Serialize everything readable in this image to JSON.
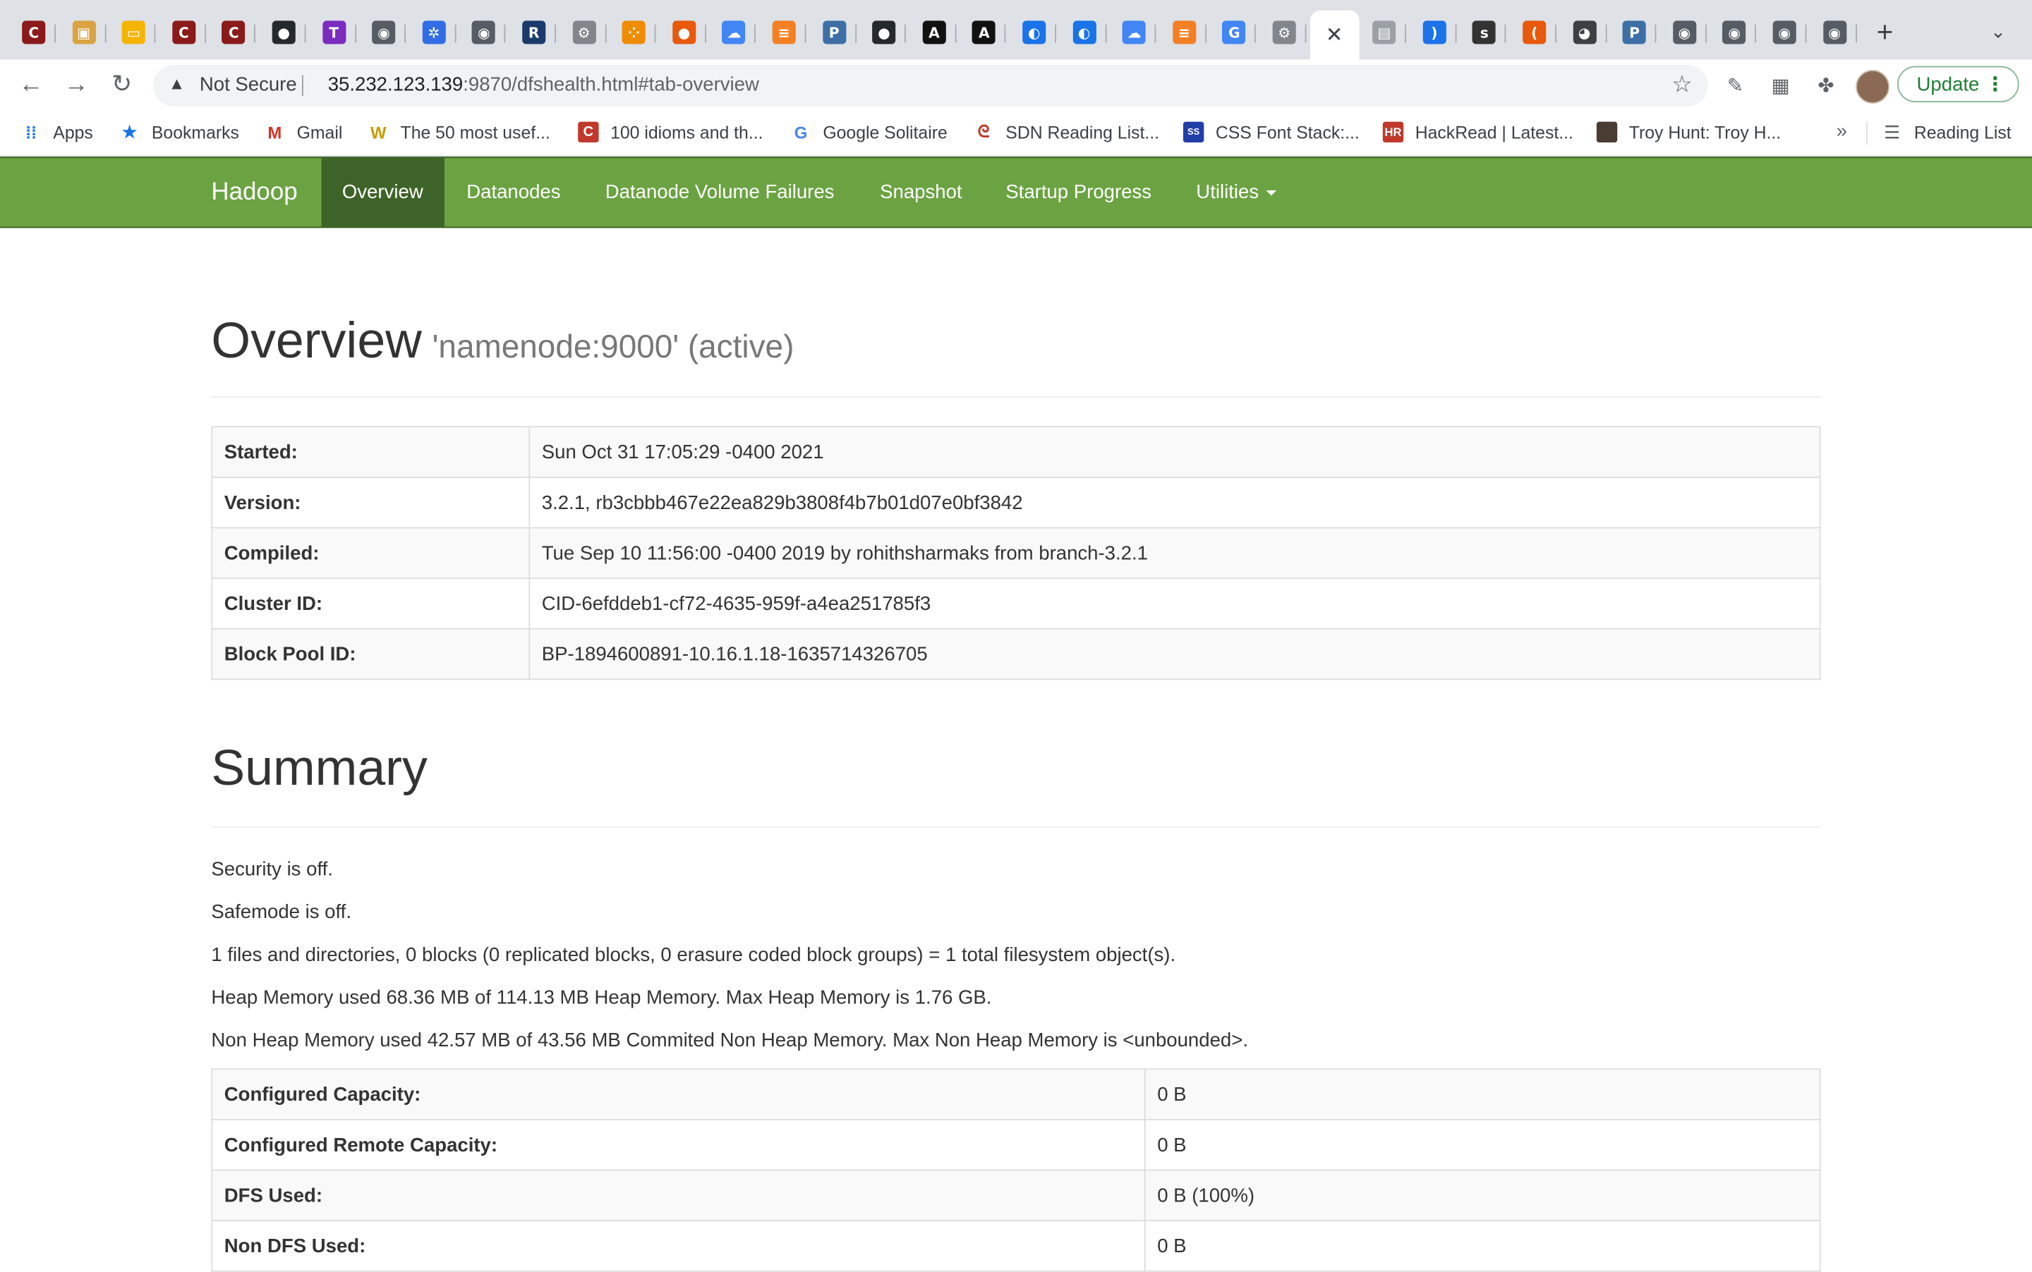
{
  "browser": {
    "tabs": [
      {
        "icon": "c-red-icon",
        "color": "#8b1a1a",
        "glyph": "C"
      },
      {
        "icon": "box-icon",
        "color": "#d9a441",
        "glyph": "▣"
      },
      {
        "icon": "slides-icon",
        "color": "#f4b400",
        "glyph": "▭"
      },
      {
        "icon": "c-red-icon",
        "color": "#8b1a1a",
        "glyph": "C"
      },
      {
        "icon": "c-red-icon",
        "color": "#8b1a1a",
        "glyph": "C"
      },
      {
        "icon": "github-icon",
        "color": "#24292e",
        "glyph": "●"
      },
      {
        "icon": "t-purple-icon",
        "color": "#7b2cbf",
        "glyph": "T"
      },
      {
        "icon": "docker-icon",
        "color": "#555c63",
        "glyph": "◉"
      },
      {
        "icon": "kubernetes-icon",
        "color": "#326ce5",
        "glyph": "✲"
      },
      {
        "icon": "docker-icon",
        "color": "#555c63",
        "glyph": "◉"
      },
      {
        "icon": "rm-icon",
        "color": "#1b3a6b",
        "glyph": "R"
      },
      {
        "icon": "gear-icon",
        "color": "#80868b",
        "glyph": "⚙"
      },
      {
        "icon": "dots-orange-icon",
        "color": "#f08c00",
        "glyph": "⁘"
      },
      {
        "icon": "orange-circle-icon",
        "color": "#e8590c",
        "glyph": "●"
      },
      {
        "icon": "cloud-icon",
        "color": "#4285f4",
        "glyph": "☁"
      },
      {
        "icon": "stackoverflow-icon",
        "color": "#f48024",
        "glyph": "≡"
      },
      {
        "icon": "p-blue-icon",
        "color": "#3d6fa6",
        "glyph": "P"
      },
      {
        "icon": "github-icon",
        "color": "#24292e",
        "glyph": "●"
      },
      {
        "icon": "a-dark-icon",
        "color": "#111111",
        "glyph": "A"
      },
      {
        "icon": "a-dark-icon",
        "color": "#111111",
        "glyph": "A"
      },
      {
        "icon": "globe-blue-icon",
        "color": "#1a73e8",
        "glyph": "◐"
      },
      {
        "icon": "globe-blue-icon",
        "color": "#1a73e8",
        "glyph": "◐"
      },
      {
        "icon": "cloud-icon",
        "color": "#4285f4",
        "glyph": "☁"
      },
      {
        "icon": "stackoverflow-icon",
        "color": "#f48024",
        "glyph": "≡"
      },
      {
        "icon": "google-icon",
        "color": "#4285f4",
        "glyph": "G"
      },
      {
        "icon": "gear-icon",
        "color": "#80868b",
        "glyph": "⚙"
      },
      {
        "icon": "close-icon",
        "active": true,
        "glyph": "✕"
      },
      {
        "icon": "monitor-icon",
        "color": "#9aa0a6",
        "glyph": "▤"
      },
      {
        "icon": "wave-icon",
        "color": "#1a73e8",
        "glyph": ")"
      },
      {
        "icon": "spok-icon",
        "color": "#333333",
        "glyph": "s"
      },
      {
        "icon": "arc-orange-icon",
        "color": "#e8590c",
        "glyph": "("
      },
      {
        "icon": "globe-dark-icon",
        "color": "#3c4043",
        "glyph": "◕"
      },
      {
        "icon": "p-blue-icon",
        "color": "#3d6fa6",
        "glyph": "P"
      },
      {
        "icon": "docker-icon",
        "color": "#555c63",
        "glyph": "◉"
      },
      {
        "icon": "docker-icon",
        "color": "#555c63",
        "glyph": "◉"
      },
      {
        "icon": "docker-icon",
        "color": "#555c63",
        "glyph": "◉"
      },
      {
        "icon": "docker-icon",
        "color": "#555c63",
        "glyph": "◉"
      }
    ],
    "url": {
      "security_label": "Not Secure",
      "host": "35.232.123.139",
      "rest": ":9870/dfshealth.html#tab-overview"
    },
    "update_label": "Update",
    "bookmarks": [
      {
        "label": "Apps",
        "icon": "apps-grid-icon"
      },
      {
        "label": "Bookmarks",
        "icon": "star-icon"
      },
      {
        "label": "Gmail",
        "icon": "gmail-icon"
      },
      {
        "label": "The 50 most usef...",
        "icon": "w-icon"
      },
      {
        "label": "100 idioms and th...",
        "icon": "c-red-icon"
      },
      {
        "label": "Google Solitaire",
        "icon": "google-icon"
      },
      {
        "label": "SDN Reading List...",
        "icon": "acrobat-icon"
      },
      {
        "label": "CSS Font Stack:...",
        "icon": "cssfontstack-icon"
      },
      {
        "label": "HackRead | Latest...",
        "icon": "hr-icon"
      },
      {
        "label": "Troy Hunt: Troy H...",
        "icon": "troyhunt-icon"
      }
    ],
    "reading_list_label": "Reading List"
  },
  "navbar": {
    "brand": "Hadoop",
    "items": [
      {
        "label": "Overview",
        "active": true
      },
      {
        "label": "Datanodes"
      },
      {
        "label": "Datanode Volume Failures"
      },
      {
        "label": "Snapshot"
      },
      {
        "label": "Startup Progress"
      },
      {
        "label": "Utilities",
        "dropdown": true
      }
    ],
    "brand_color": "#6ba342",
    "active_color": "#3e6328"
  },
  "overview": {
    "title": "Overview",
    "subtitle": "'namenode:9000' (active)",
    "rows": [
      {
        "key": "Started:",
        "value": "Sun Oct 31 17:05:29 -0400 2021"
      },
      {
        "key": "Version:",
        "value": "3.2.1, rb3cbbb467e22ea829b3808f4b7b01d07e0bf3842"
      },
      {
        "key": "Compiled:",
        "value": "Tue Sep 10 11:56:00 -0400 2019 by rohithsharmaks from branch-3.2.1"
      },
      {
        "key": "Cluster ID:",
        "value": "CID-6efddeb1-cf72-4635-959f-a4ea251785f3"
      },
      {
        "key": "Block Pool ID:",
        "value": "BP-1894600891-10.16.1.18-1635714326705"
      }
    ]
  },
  "summary": {
    "title": "Summary",
    "lines": [
      "Security is off.",
      "Safemode is off.",
      "1 files and directories, 0 blocks (0 replicated blocks, 0 erasure coded block groups) = 1 total filesystem object(s).",
      "Heap Memory used 68.36 MB of 114.13 MB Heap Memory. Max Heap Memory is 1.76 GB.",
      "Non Heap Memory used 42.57 MB of 43.56 MB Commited Non Heap Memory. Max Non Heap Memory is <unbounded>."
    ],
    "rows": [
      {
        "key": "Configured Capacity:",
        "value": "0 B"
      },
      {
        "key": "Configured Remote Capacity:",
        "value": "0 B"
      },
      {
        "key": "DFS Used:",
        "value": "0 B (100%)"
      },
      {
        "key": "Non DFS Used:",
        "value": "0 B"
      }
    ]
  }
}
